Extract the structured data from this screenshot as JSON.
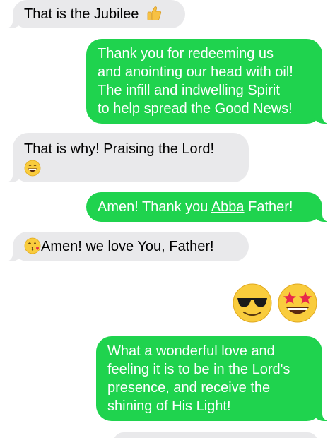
{
  "messages": [
    {
      "side": "incoming",
      "text": "That is the Jubilee",
      "emoji": "thumbs-up-icon"
    },
    {
      "side": "outgoing",
      "text": "Thank you for redeeming us\nand anointing our head with oil!\nThe infill and indwelling Spirit\nto help spread the Good News!"
    },
    {
      "side": "incoming",
      "text": "That is why!  Praising the Lord!",
      "emoji": "grinning-face-icon"
    },
    {
      "side": "outgoing",
      "text_before": "Amen! Thank you ",
      "text_link": "Abba",
      "text_after": " Father!"
    },
    {
      "side": "incoming",
      "emoji": "face-blowing-kiss-icon",
      "text": "Amen!  we love You, Father!"
    },
    {
      "side": "outgoing",
      "emojis": [
        "sunglasses-face-icon",
        "star-struck-face-icon"
      ]
    },
    {
      "side": "outgoing",
      "text": "What a wonderful love and\nfeeling it is to be in the Lord's\npresence, and receive the\nshining of His Light!"
    }
  ],
  "colors": {
    "outgoing_bubble": "#1fd34e",
    "incoming_bubble": "#e9e9eb",
    "outgoing_text": "#ffffff",
    "incoming_text": "#000000"
  }
}
